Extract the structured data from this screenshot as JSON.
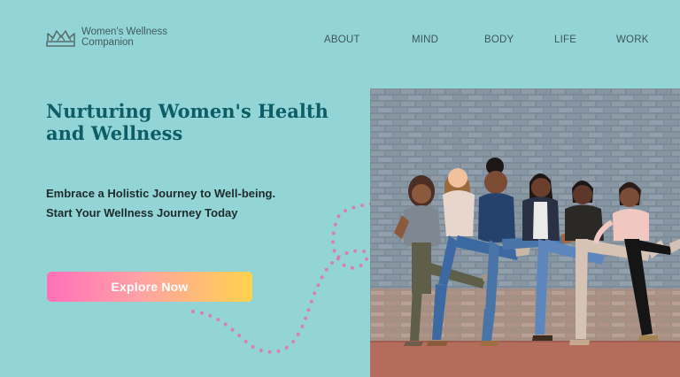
{
  "brand": {
    "name_line1": "Women's Wellness",
    "name_line2": "Companion"
  },
  "nav": {
    "items": [
      "ABOUT",
      "MIND",
      "BODY",
      "LIFE",
      "WORK"
    ]
  },
  "hero": {
    "title": "Nurturing Women's Health and Wellness",
    "subtitle": "Embrace a Holistic Journey to Well-being. Start Your Wellness Journey Today",
    "cta": "Explore Now"
  },
  "colors": {
    "background": "#93d5d6",
    "title": "#0d5d67",
    "text": "#1e2a2b",
    "nav": "#3f5558",
    "button_start": "#ff70b8",
    "button_end": "#ffd24d",
    "accent_dots": "#d87fb2"
  }
}
